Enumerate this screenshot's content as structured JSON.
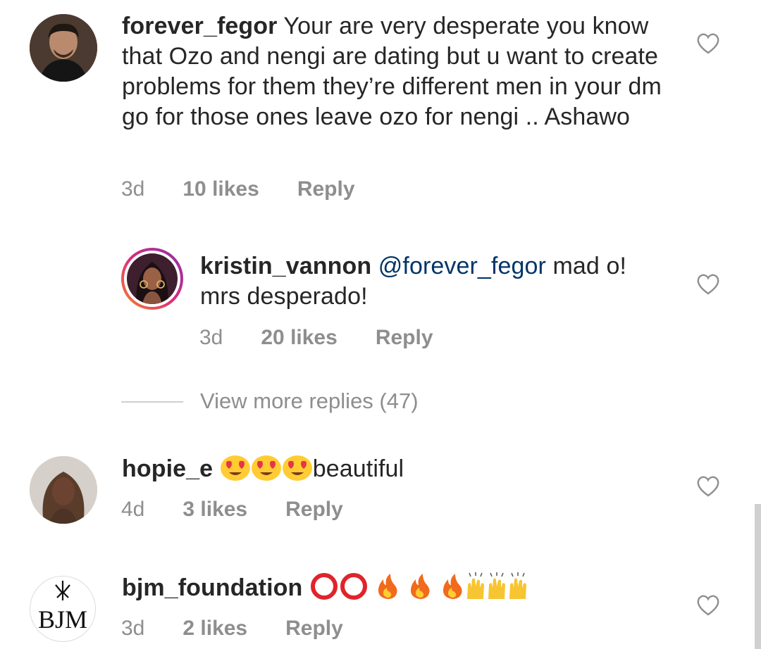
{
  "comments": [
    {
      "username": "forever_fegor",
      "text": " Your are very desperate you know that Ozo and nengi are dating but u want to create problems for them they’re different men in your dm go for those ones leave ozo for nengi .. Ashawo",
      "time": "3d",
      "likes": "10 likes",
      "reply": "Reply",
      "avatar_icon": "man-portrait-avatar"
    },
    {
      "username": "kristin_vannon",
      "mention": "@forever_fegor",
      "text": " mad o! mrs desperado!",
      "time": "3d",
      "likes": "20 likes",
      "reply": "Reply",
      "avatar_icon": "woman-portrait-story-ring-avatar"
    },
    {
      "username": "hopie_e",
      "text": "beautiful",
      "emojis": [
        "heart-eyes-emoji",
        "heart-eyes-emoji",
        "heart-eyes-emoji"
      ],
      "time": "4d",
      "likes": "3 likes",
      "reply": "Reply",
      "avatar_icon": "woman-portrait-avatar"
    },
    {
      "username": "bjm_foundation",
      "emojis": [
        "hollow-red-circle-emoji",
        "hollow-red-circle-emoji",
        "fire-emoji",
        "fire-emoji",
        "fire-emoji",
        "raising-hands-emoji",
        "raising-hands-emoji",
        "raising-hands-emoji"
      ],
      "time": "3d",
      "likes": "2 likes",
      "reply": "Reply",
      "avatar_text": "BJM",
      "avatar_icon": "bjm-logo-avatar"
    }
  ],
  "view_more": "View more replies (47)",
  "colors": {
    "text": "#262626",
    "secondary": "#8e8e8e",
    "mention": "#003569",
    "story_ring_start": "#f58529",
    "story_ring_end": "#dd2a7b"
  }
}
